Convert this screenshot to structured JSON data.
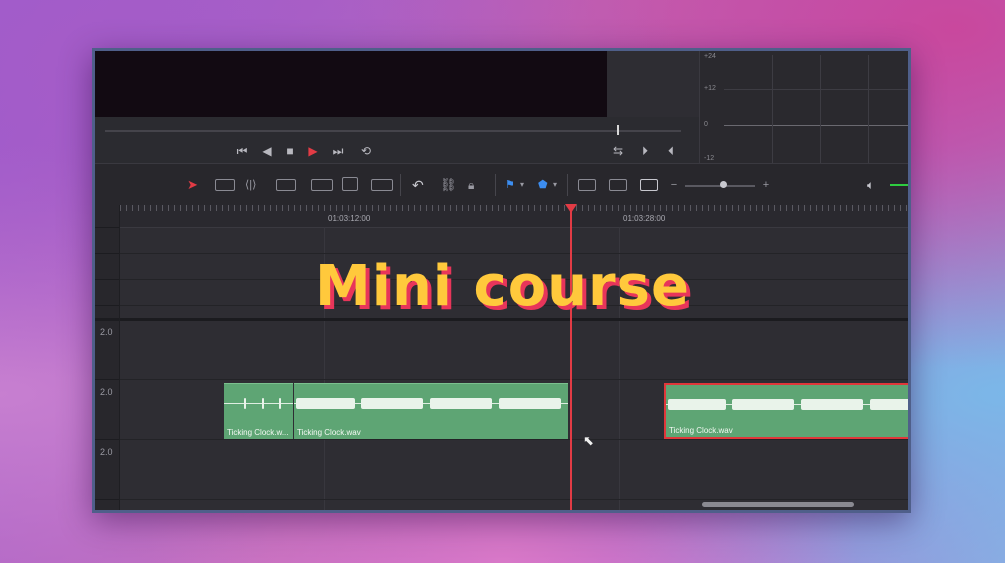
{
  "overlay_title": "Mini course",
  "meter": {
    "labels": [
      "+24",
      "+12",
      "0",
      "-12"
    ]
  },
  "transport": {
    "buttons": [
      "skip-to-start-icon",
      "play-reverse-icon",
      "stop-icon",
      "play-icon",
      "skip-to-end-icon",
      "loop-icon"
    ],
    "right_buttons": [
      "match-frame-icon",
      "next-edit-icon",
      "prev-edit-icon"
    ]
  },
  "toolbar": {
    "tools": [
      "selection-arrow",
      "trim-edit",
      "dynamic-trim",
      "blade-edit",
      "insert-clip",
      "overwrite-clip",
      "replace-clip",
      "snapping",
      "linked-selection",
      "position-lock",
      "flag",
      "marker",
      "zoom-full",
      "zoom-detail",
      "zoom-custom"
    ],
    "zoom_minus": "−",
    "zoom_plus": "+",
    "colors": {
      "active": "#e23b45",
      "flag": "#3c8df0",
      "volume": "#2ecc40"
    }
  },
  "timeline": {
    "ruler": [
      "01:03:12:00",
      "01:03:28:00"
    ],
    "track_levels": [
      "2.0",
      "2.0",
      "2.0"
    ],
    "clips": [
      {
        "name": "Ticking Clock.w...",
        "selected": false
      },
      {
        "name": "Ticking Clock.wav",
        "selected": false
      },
      {
        "name": "Ticking Clock.wav",
        "selected": true
      }
    ],
    "colors": {
      "clip": "#5ea574",
      "playhead": "#e23b45"
    }
  }
}
